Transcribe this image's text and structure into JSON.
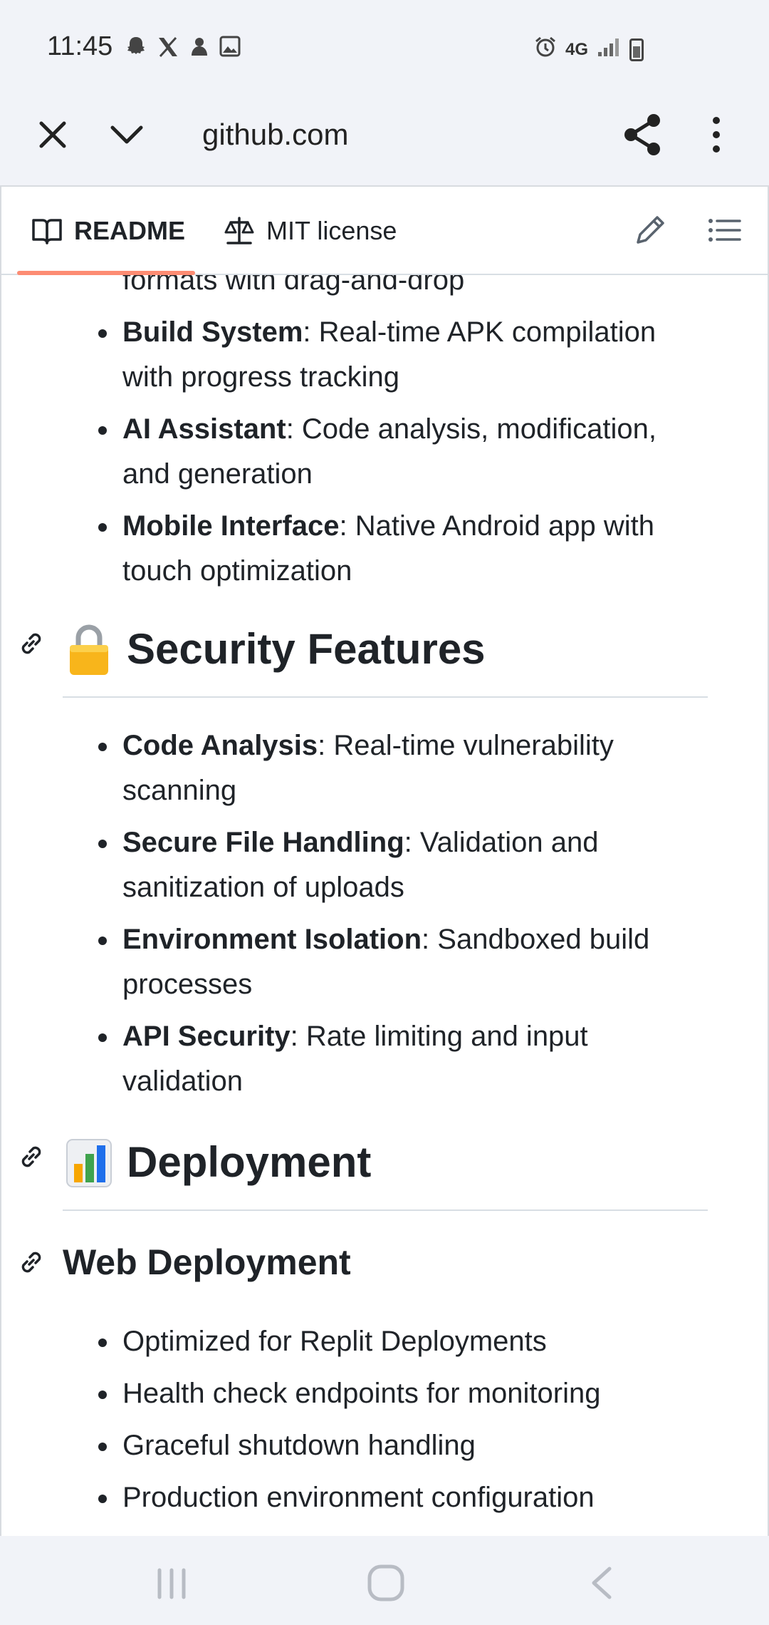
{
  "status_bar": {
    "time": "11:45",
    "left_icons": [
      "snapchat-icon",
      "x-icon",
      "notification-icon",
      "gallery-icon"
    ],
    "right_icons": [
      "alarm-icon",
      "4g-icon",
      "signal-icon",
      "battery-charging-icon"
    ],
    "network": "4G"
  },
  "toolbar": {
    "url": "github.com",
    "icons": [
      "close-icon",
      "chevron-down-icon",
      "share-icon",
      "more-vert-icon"
    ]
  },
  "tabs": {
    "readme": "README",
    "license": "MIT license"
  },
  "content": {
    "partial_top_text": "formats with drag-and-drop",
    "features": [
      {
        "bold": "Build System",
        "rest": ": Real-time APK compilation with progress tracking"
      },
      {
        "bold": "AI Assistant",
        "rest": ": Code analysis, modification, and generation"
      },
      {
        "bold": "Mobile Interface",
        "rest": ": Native Android app with touch optimization"
      }
    ],
    "security_heading": "Security Features",
    "security_emoji": "lock",
    "security": [
      {
        "bold": "Code Analysis",
        "rest": ": Real-time vulnerability scanning"
      },
      {
        "bold": "Secure File Handling",
        "rest": ": Validation and sanitization of uploads"
      },
      {
        "bold": "Environment Isolation",
        "rest": ": Sandboxed build processes"
      },
      {
        "bold": "API Security",
        "rest": ": Rate limiting and input validation"
      }
    ],
    "deployment_heading": "Deployment",
    "deployment_emoji": "bar-chart",
    "web_deployment_heading": "Web Deployment",
    "web_deployment": [
      "Optimized for Replit Deployments",
      "Health check endpoints for monitoring",
      "Graceful shutdown handling",
      "Production environment configuration"
    ]
  },
  "colors": {
    "accent_underline": "#fd8c73",
    "text": "#1f2328",
    "chrome_bg": "#f1f3f8"
  }
}
